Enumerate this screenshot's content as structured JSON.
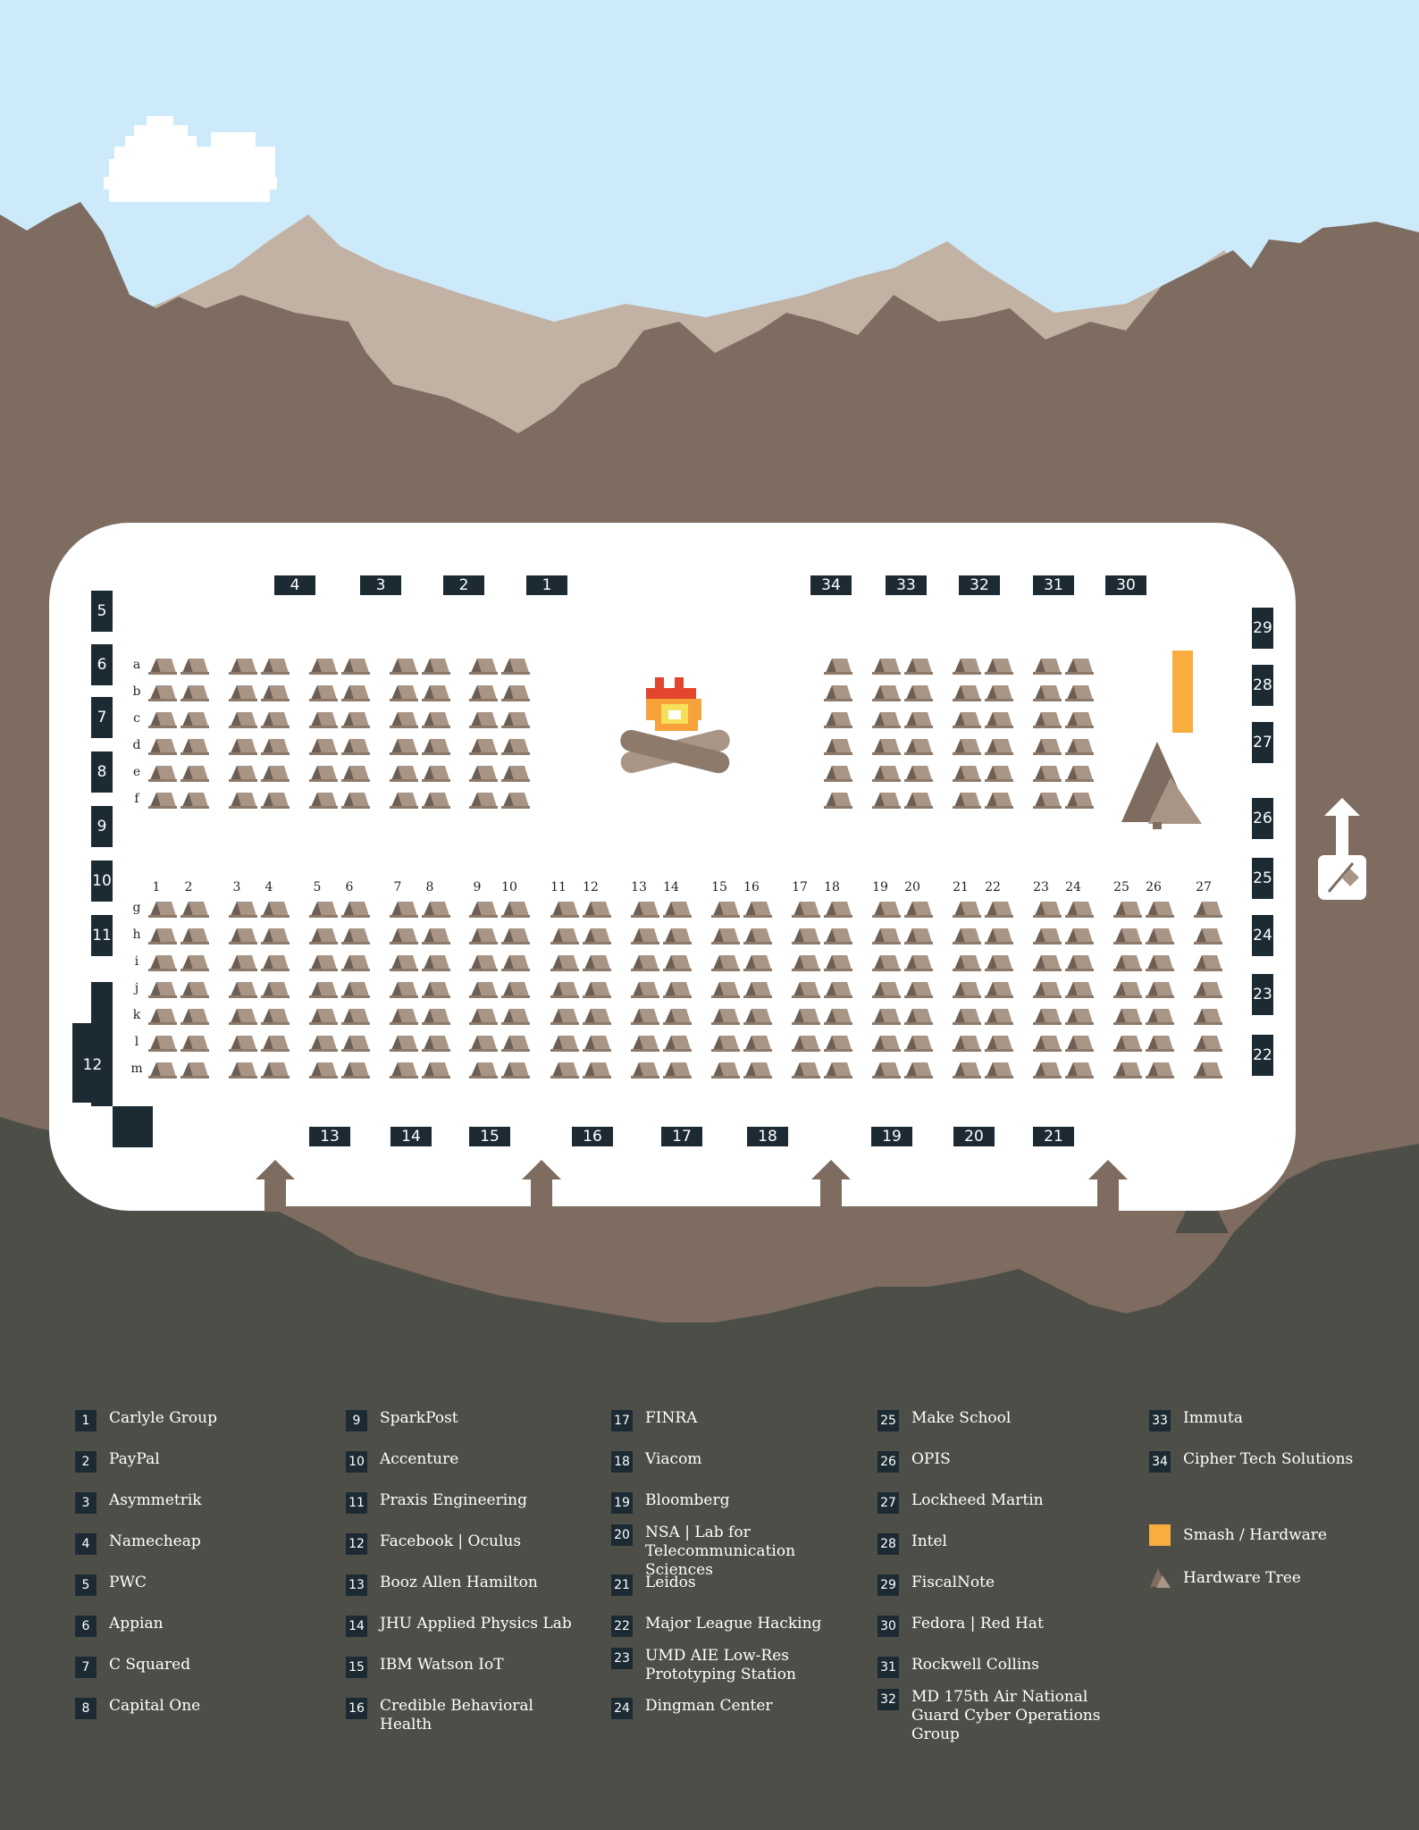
{
  "colors": {
    "sky": "#cdeafa",
    "far_mountain": "#c2b2a3",
    "near_mountain": "#7d6c5f",
    "ground": "#4d4e48",
    "hall": "#ffffff",
    "booth": "#1c2b33",
    "tent_light": "#a89585",
    "tent_dark": "#6e5f54",
    "smash_hardware": "#f9ad3e"
  },
  "venue": {
    "top_booths": [
      "4",
      "3",
      "2",
      "1",
      "34",
      "33",
      "32",
      "31",
      "30"
    ],
    "bottom_booths": [
      "13",
      "14",
      "15",
      "16",
      "17",
      "18",
      "19",
      "20",
      "21"
    ],
    "left_booths": [
      "5",
      "6",
      "7",
      "8",
      "9",
      "10",
      "11"
    ],
    "left_big_booth": "12",
    "right_booths": [
      "29",
      "28",
      "27",
      "26",
      "25",
      "24",
      "23",
      "22"
    ],
    "upper_row_labels": [
      "a",
      "b",
      "c",
      "d",
      "e",
      "f"
    ],
    "lower_row_labels": [
      "g",
      "h",
      "i",
      "j",
      "k",
      "l",
      "m"
    ],
    "column_labels": [
      "1",
      "2",
      "3",
      "4",
      "5",
      "6",
      "7",
      "8",
      "9",
      "10",
      "11",
      "12",
      "13",
      "14",
      "15",
      "16",
      "17",
      "18",
      "19",
      "20",
      "21",
      "22",
      "23",
      "24",
      "25",
      "26",
      "27"
    ]
  },
  "legend": [
    {
      "num": "1",
      "name": "Carlyle Group"
    },
    {
      "num": "2",
      "name": "PayPal"
    },
    {
      "num": "3",
      "name": "Asymmetrik"
    },
    {
      "num": "4",
      "name": "Namecheap"
    },
    {
      "num": "5",
      "name": "PWC"
    },
    {
      "num": "6",
      "name": "Appian"
    },
    {
      "num": "7",
      "name": "C Squared"
    },
    {
      "num": "8",
      "name": "Capital One"
    },
    {
      "num": "9",
      "name": "SparkPost"
    },
    {
      "num": "10",
      "name": "Accenture"
    },
    {
      "num": "11",
      "name": "Praxis Engineering"
    },
    {
      "num": "12",
      "name": "Facebook | Oculus"
    },
    {
      "num": "13",
      "name": "Booz Allen Hamilton"
    },
    {
      "num": "14",
      "name": "JHU Applied Physics Lab"
    },
    {
      "num": "15",
      "name": "IBM Watson IoT"
    },
    {
      "num": "16",
      "name": "Credible Behavioral Health"
    },
    {
      "num": "17",
      "name": "FINRA"
    },
    {
      "num": "18",
      "name": "Viacom"
    },
    {
      "num": "19",
      "name": "Bloomberg"
    },
    {
      "num": "20",
      "name": "NSA | Lab for Telecommunication Sciences"
    },
    {
      "num": "21",
      "name": "Leidos"
    },
    {
      "num": "22",
      "name": "Major League Hacking"
    },
    {
      "num": "23",
      "name": "UMD AIE Low-Res Prototyping Station"
    },
    {
      "num": "24",
      "name": "Dingman Center"
    },
    {
      "num": "25",
      "name": "Make School"
    },
    {
      "num": "26",
      "name": "OPIS"
    },
    {
      "num": "27",
      "name": "Lockheed Martin"
    },
    {
      "num": "28",
      "name": "Intel"
    },
    {
      "num": "29",
      "name": "FiscalNote"
    },
    {
      "num": "30",
      "name": "Fedora | Red Hat"
    },
    {
      "num": "31",
      "name": "Rockwell Collins"
    },
    {
      "num": "32",
      "name": "MD 175th Air National Guard Cyber Operations Group"
    },
    {
      "num": "33",
      "name": "Immuta"
    },
    {
      "num": "34",
      "name": "Cipher Tech Solutions"
    }
  ],
  "key": {
    "smash_hardware": "Smash / Hardware",
    "hardware_tree": "Hardware Tree"
  },
  "icons": [
    "cloud-icon",
    "campfire-icon",
    "hardware-tree-icon",
    "marshmallow-roast-icon",
    "entrance-arrow-icon",
    "tent-icon"
  ]
}
